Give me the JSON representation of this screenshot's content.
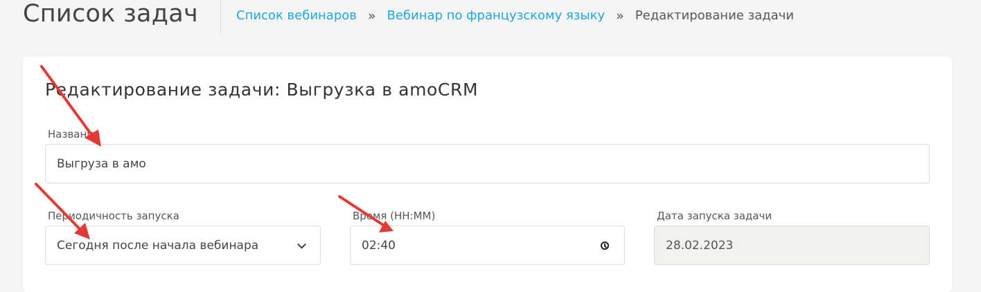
{
  "header": {
    "page_title": "Список задач",
    "breadcrumb": {
      "items": [
        {
          "label": "Список вебинаров",
          "link": true
        },
        {
          "label": "Вебинар по французскому языку",
          "link": true
        },
        {
          "label": "Редактирование задачи",
          "link": false
        }
      ],
      "separator": "»"
    }
  },
  "form": {
    "title": "Редактирование задачи: Выгрузка в amoCRM",
    "name": {
      "label": "Название",
      "value": "Выгруза в амо"
    },
    "periodicity": {
      "label": "Периодичность запуска",
      "selected": "Сегодня после начала вебинара",
      "icon": "chevron-down-icon"
    },
    "time": {
      "label": "Время (HH:MM)",
      "value": "02:40",
      "icon": "clock-icon"
    },
    "start_date": {
      "label": "Дата запуска задачи",
      "value": "28.02.2023"
    }
  },
  "colors": {
    "link": "#1ea7d9",
    "annotation_arrow": "#e53935",
    "readonly_bg": "#f1f1ee"
  }
}
